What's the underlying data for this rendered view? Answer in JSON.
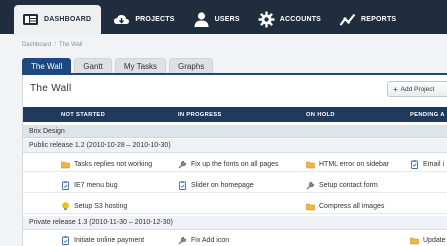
{
  "nav": {
    "items": [
      {
        "label": "DASHBOARD",
        "icon": "dashboard-icon",
        "active": true
      },
      {
        "label": "PROJECTS",
        "icon": "cloud-icon",
        "active": false
      },
      {
        "label": "USERS",
        "icon": "user-icon",
        "active": false
      },
      {
        "label": "ACCOUNTS",
        "icon": "gear-icon",
        "active": false
      },
      {
        "label": "REPORTS",
        "icon": "chart-icon",
        "active": false
      }
    ]
  },
  "breadcrumb": {
    "root": "Dashboard",
    "separator": "/",
    "current": "The Wall"
  },
  "tabs": [
    {
      "label": "The Wall",
      "active": true
    },
    {
      "label": "Gantt",
      "active": false
    },
    {
      "label": "My Tasks",
      "active": false
    },
    {
      "label": "Graphs",
      "active": false
    }
  ],
  "panel": {
    "title": "The Wall",
    "add_button": {
      "plus": "+",
      "label": "Add Project"
    }
  },
  "columns": [
    "NOT STARTED",
    "IN PROGRESS",
    "ON HOLD",
    "PENDING A"
  ],
  "project": {
    "name": "Brix Design"
  },
  "releases": [
    {
      "label": "Public release 1.2 (2010-10-28 – 2010-10-30)",
      "rows": [
        [
          {
            "text": "Tasks replies not working",
            "icon": "folder-icon"
          },
          {
            "text": "Fix up the fonts on all pages",
            "icon": "wrench-icon"
          },
          {
            "text": "HTML error on sidebar",
            "icon": "folder-icon"
          },
          {
            "text": "Email i",
            "icon": "clipboard-icon"
          }
        ],
        [
          {
            "text": "IE7 menu bug",
            "icon": "clipboard-icon"
          },
          {
            "text": "Slider on homepage",
            "icon": "clipboard-icon"
          },
          {
            "text": "Setup contact form",
            "icon": "wrench-icon"
          },
          {
            "text": "",
            "icon": ""
          }
        ],
        [
          {
            "text": "Setup S3 hosting",
            "icon": "lightbulb-icon"
          },
          {
            "text": "",
            "icon": ""
          },
          {
            "text": "Compress all images",
            "icon": "folder-icon"
          },
          {
            "text": "",
            "icon": ""
          }
        ]
      ]
    },
    {
      "label": "Private release 1.3 (2010-11-30 – 2010-12-30)",
      "rows": [
        [
          {
            "text": "Initiate online payment",
            "icon": "clipboard-icon"
          },
          {
            "text": "Fix Add icon",
            "icon": "wrench-icon"
          },
          {
            "text": "",
            "icon": ""
          },
          {
            "text": "Update",
            "icon": "folder-icon"
          }
        ]
      ]
    }
  ],
  "colors": {
    "topbar": "#1f2d3f",
    "accent": "#1c4a7e",
    "header": "#1f3a5c",
    "folder": "#f0b73b",
    "bulb": "#f5c400",
    "clipboard": "#3a6ea8"
  }
}
